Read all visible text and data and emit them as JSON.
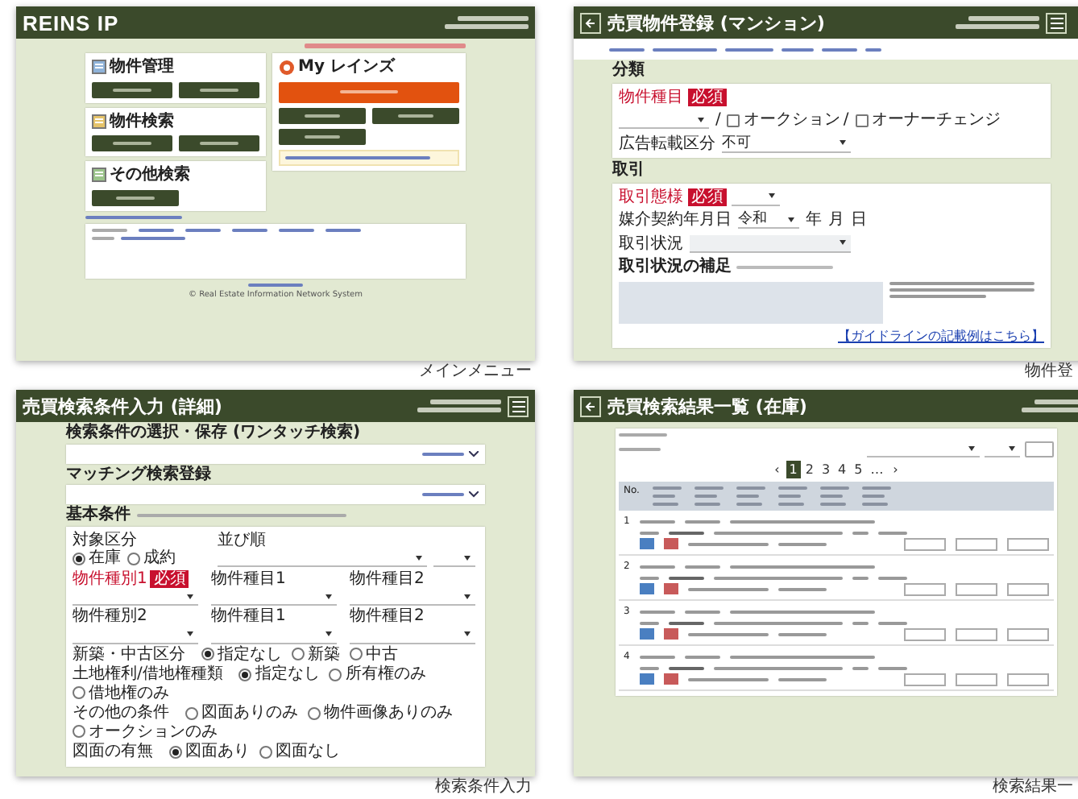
{
  "menu": {
    "caption": "メインメニュー",
    "logo": "REINS IP",
    "sections": [
      {
        "title": "物件管理"
      },
      {
        "title": "物件検索"
      },
      {
        "title": "その他検索"
      }
    ],
    "my_reins": {
      "title": "My レインズ"
    },
    "copyright": "© Real Estate Information Network System"
  },
  "register": {
    "caption": "物件登",
    "title": "売買物件登録 (マンション)",
    "classification": {
      "heading": "分類",
      "type_label": "物件種目",
      "required": "必須",
      "separator": "/",
      "options": [
        {
          "label": "オークション",
          "checked": false
        },
        {
          "label": "オーナーチェンジ",
          "checked": false
        }
      ],
      "ad_label": "広告転載区分",
      "ad_value": "不可"
    },
    "deal": {
      "heading": "取引",
      "mode_label": "取引態様",
      "required": "必須",
      "date_label": "媒介契約年月日",
      "era": "令和",
      "date_units": [
        "年",
        "月",
        "日"
      ],
      "status_label": "取引状況",
      "note_label": "取引状況の補足",
      "guide_link": "【ガイドラインの記載例はこちら】"
    }
  },
  "search": {
    "caption": "検索条件入力",
    "title": "売買検索条件入力 (詳細)",
    "saved_heading": "検索条件の選択・保存 (ワンタッチ検索)",
    "matching_heading": "マッチング検索登録",
    "basic_heading": "基本条件",
    "target": {
      "label": "対象区分",
      "options": [
        {
          "label": "在庫",
          "selected": true
        },
        {
          "label": "成約",
          "selected": false
        }
      ]
    },
    "sort_label": "並び順",
    "type_labels": [
      {
        "label": "物件種別1",
        "required": "必須"
      },
      {
        "label": "物件種目1"
      },
      {
        "label": "物件種目2"
      },
      {
        "label": "物件種別2"
      },
      {
        "label": "物件種目1"
      },
      {
        "label": "物件種目2"
      }
    ],
    "radio_groups": [
      {
        "label": "新築・中古区分",
        "options": [
          {
            "label": "指定なし",
            "selected": true
          },
          {
            "label": "新築",
            "selected": false
          },
          {
            "label": "中古",
            "selected": false
          }
        ]
      },
      {
        "label": "土地権利/借地権種類",
        "options": [
          {
            "label": "指定なし",
            "selected": true
          },
          {
            "label": "所有権のみ",
            "selected": false
          },
          {
            "label": "借地権のみ",
            "selected": false
          }
        ]
      },
      {
        "label": "その他の条件",
        "options": [
          {
            "label": "図面ありのみ",
            "selected": false
          },
          {
            "label": "物件画像ありのみ",
            "selected": false
          },
          {
            "label": "オークションのみ",
            "selected": false
          }
        ]
      },
      {
        "label": "図面の有無",
        "options": [
          {
            "label": "図面あり",
            "selected": true
          },
          {
            "label": "図面なし",
            "selected": false
          }
        ]
      }
    ]
  },
  "results": {
    "caption": "検索結果一",
    "title": "売買検索結果一覧 (在庫)",
    "no_header": "No.",
    "pages": [
      {
        "label": "‹",
        "selected": false
      },
      {
        "label": "1",
        "selected": true
      },
      {
        "label": "2",
        "selected": false
      },
      {
        "label": "3",
        "selected": false
      },
      {
        "label": "4",
        "selected": false
      },
      {
        "label": "5",
        "selected": false
      },
      {
        "label": "…",
        "selected": false
      },
      {
        "label": "›",
        "selected": false
      }
    ],
    "rows": [
      {
        "no": "1"
      },
      {
        "no": "2"
      },
      {
        "no": "3"
      },
      {
        "no": "4"
      }
    ]
  }
}
